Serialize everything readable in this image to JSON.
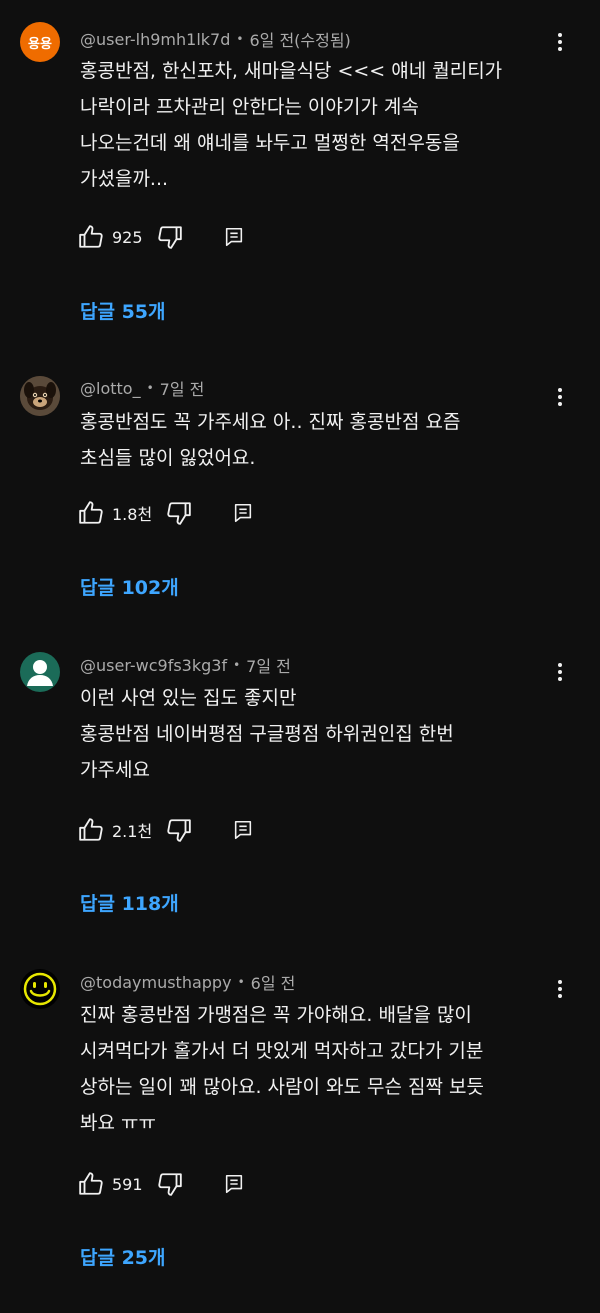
{
  "colors": {
    "background": "#0f0f0f",
    "text": "#f1f1f1",
    "secondary_text": "#aaaaaa",
    "link": "#3ea6ff"
  },
  "comments": [
    {
      "avatar_text": "용용",
      "avatar_color": "#ef6c00",
      "handle": "@user-lh9mh1lk7d",
      "time": "6일 전(수정됨)",
      "text": "홍콩반점, 한신포차, 새마을식당 <<< 얘네 퀄리티가\n나락이라 프차관리 안한다는 이야기가 계속\n나오는건데 왜 얘네를 놔두고 멀쩡한 역전우동을\n가셨을까...",
      "likes": "925",
      "replies": "답글 55개"
    },
    {
      "avatar_text": "",
      "avatar_color": "#3a2a1c",
      "handle": "@lotto_",
      "time": "7일 전",
      "text": "홍콩반점도 꼭 가주세요 아.. 진짜 홍콩반점 요즘\n초심들 많이 잃었어요.",
      "likes": "1.8천",
      "replies": "답글 102개"
    },
    {
      "avatar_text": "",
      "avatar_color": "#1b6b58",
      "handle": "@user-wc9fs3kg3f",
      "time": "7일 전",
      "text": "이런 사연 있는 집도 좋지만\n홍콩반점 네이버평점 구글평점 하위권인집 한번\n가주세요",
      "likes": "2.1천",
      "replies": "답글 118개"
    },
    {
      "avatar_text": "",
      "avatar_color": "#000000",
      "handle": "@todaymusthappy",
      "time": "6일 전",
      "text": "진짜 홍콩반점 가맹점은 꼭 가야해요. 배달을 많이\n시켜먹다가 홀가서 더 맛있게 먹자하고 갔다가 기분\n상하는 일이 꽤 많아요. 사람이 와도 무슨 짐짝 보듯\n봐요 ㅠㅠ",
      "likes": "591",
      "replies": "답글 25개"
    }
  ]
}
